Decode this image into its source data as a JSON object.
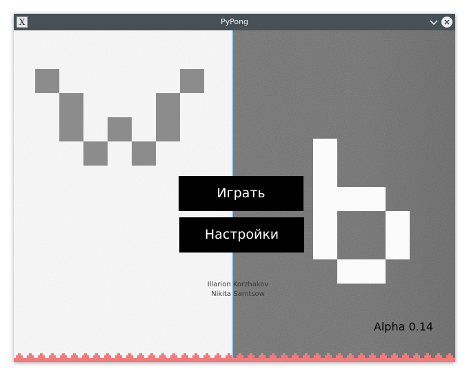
{
  "window": {
    "title": "PyPong",
    "app_icon_glyph": "X"
  },
  "colors": {
    "titlebar": "#475057",
    "left_field": "#fbfbfb",
    "right_field": "#898989",
    "divider": "#9ccaf2",
    "button_bg": "#000000",
    "button_text": "#ffffff",
    "border_pattern": "#f27a7a"
  },
  "menu": {
    "play_label": "Играть",
    "settings_label": "Настройки"
  },
  "credits": {
    "author_1": "Illarion Korzhakov",
    "author_2": "Nikita Samtsow"
  },
  "version": "Alpha 0.14",
  "logo": {
    "left_letter": "w",
    "right_letter": "b"
  }
}
